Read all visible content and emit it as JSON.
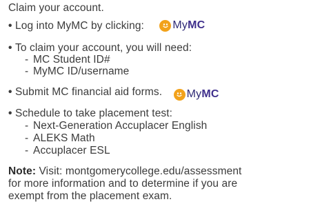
{
  "heading": "Claim your account.",
  "steps": [
    {
      "text": "Log into MyMC by clicking:",
      "logo": {
        "prefix": "My",
        "suffix": "MC",
        "icon": "mymc-logo-icon"
      }
    },
    {
      "text": "To claim your account, you will need:",
      "subitems": [
        "MC Student ID#",
        "MyMC ID/username"
      ]
    },
    {
      "text": "Submit MC financial aid forms.",
      "logo": {
        "prefix": "My",
        "suffix": "MC",
        "icon": "mymc-logo-icon"
      }
    },
    {
      "text": "Schedule to take placement test:",
      "subitems": [
        "Next-Generation Accuplacer English",
        "ALEKS Math",
        "Accuplacer ESL"
      ]
    }
  ],
  "note": {
    "label": "Note:",
    "line1": " Visit: montgomerycollege.edu/assessment",
    "line2": "for more information and to determine if you are",
    "line3": "exempt from the placement exam."
  },
  "colors": {
    "text": "#3b3b3b",
    "logo_orange": "#f2a21b",
    "logo_purple": "#3f2f8c"
  }
}
